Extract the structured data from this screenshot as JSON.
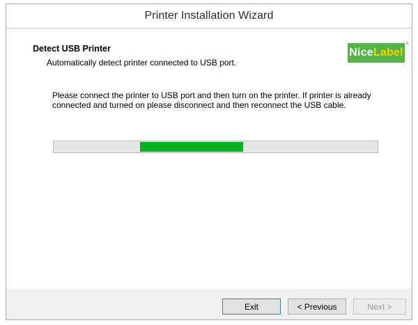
{
  "window": {
    "title": "Printer Installation Wizard"
  },
  "header": {
    "title": "Detect USB Printer",
    "subtitle": "Automatically detect printer connected to USB port.",
    "logo_nice": "Nice",
    "logo_label": "Label",
    "logo_registered": "®"
  },
  "main": {
    "message": "Please connect the printer to USB port and then turn on the printer. If printer is already connected and turned on please disconnect and then reconnect the USB cable."
  },
  "footer": {
    "exit_label": "Exit",
    "previous_label": "< Previous",
    "next_label": "Next >"
  },
  "colors": {
    "progress_fill": "#06b025",
    "logo_green": "#56b346",
    "logo_yellow": "#f6d200"
  }
}
